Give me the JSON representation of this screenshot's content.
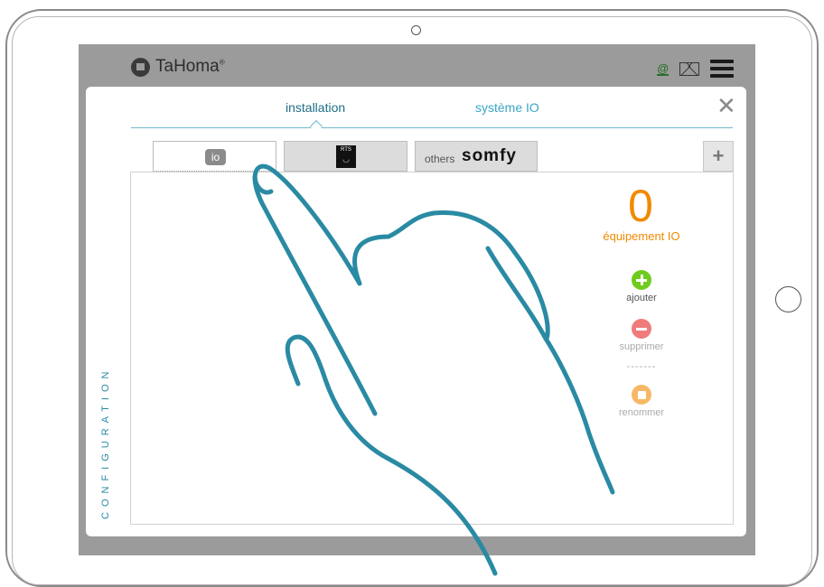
{
  "app": {
    "name": "TaHoma",
    "mark": "®"
  },
  "header": {
    "icons": [
      "at-user-icon",
      "mail-icon",
      "menu-icon"
    ],
    "at_symbol": "@"
  },
  "panel": {
    "side_label": "CONFIGURATION",
    "tabs": [
      {
        "label": "installation",
        "active": true
      },
      {
        "label": "système IO",
        "active": false
      }
    ],
    "close_symbol": "✕",
    "protocols": [
      {
        "id": "io",
        "logo": "io",
        "active": true
      },
      {
        "id": "rts",
        "logo": "RTS",
        "active": false
      },
      {
        "id": "others",
        "prefix": "others",
        "logo": "somfy",
        "active": false
      }
    ],
    "add_protocol_symbol": "+"
  },
  "summary": {
    "count": "0",
    "label": "équipement IO"
  },
  "actions": [
    {
      "label": "ajouter",
      "enabled": true,
      "color": "#6fcc1f"
    },
    {
      "label": "supprimer",
      "enabled": false,
      "color": "#ef7b7b"
    },
    {
      "separator": "-------"
    },
    {
      "label": "renommer",
      "enabled": false,
      "color": "#f6b866"
    }
  ],
  "colors": {
    "accent": "#2a8aa3",
    "count": "#f08a00",
    "hand": "#2a8aa3"
  }
}
